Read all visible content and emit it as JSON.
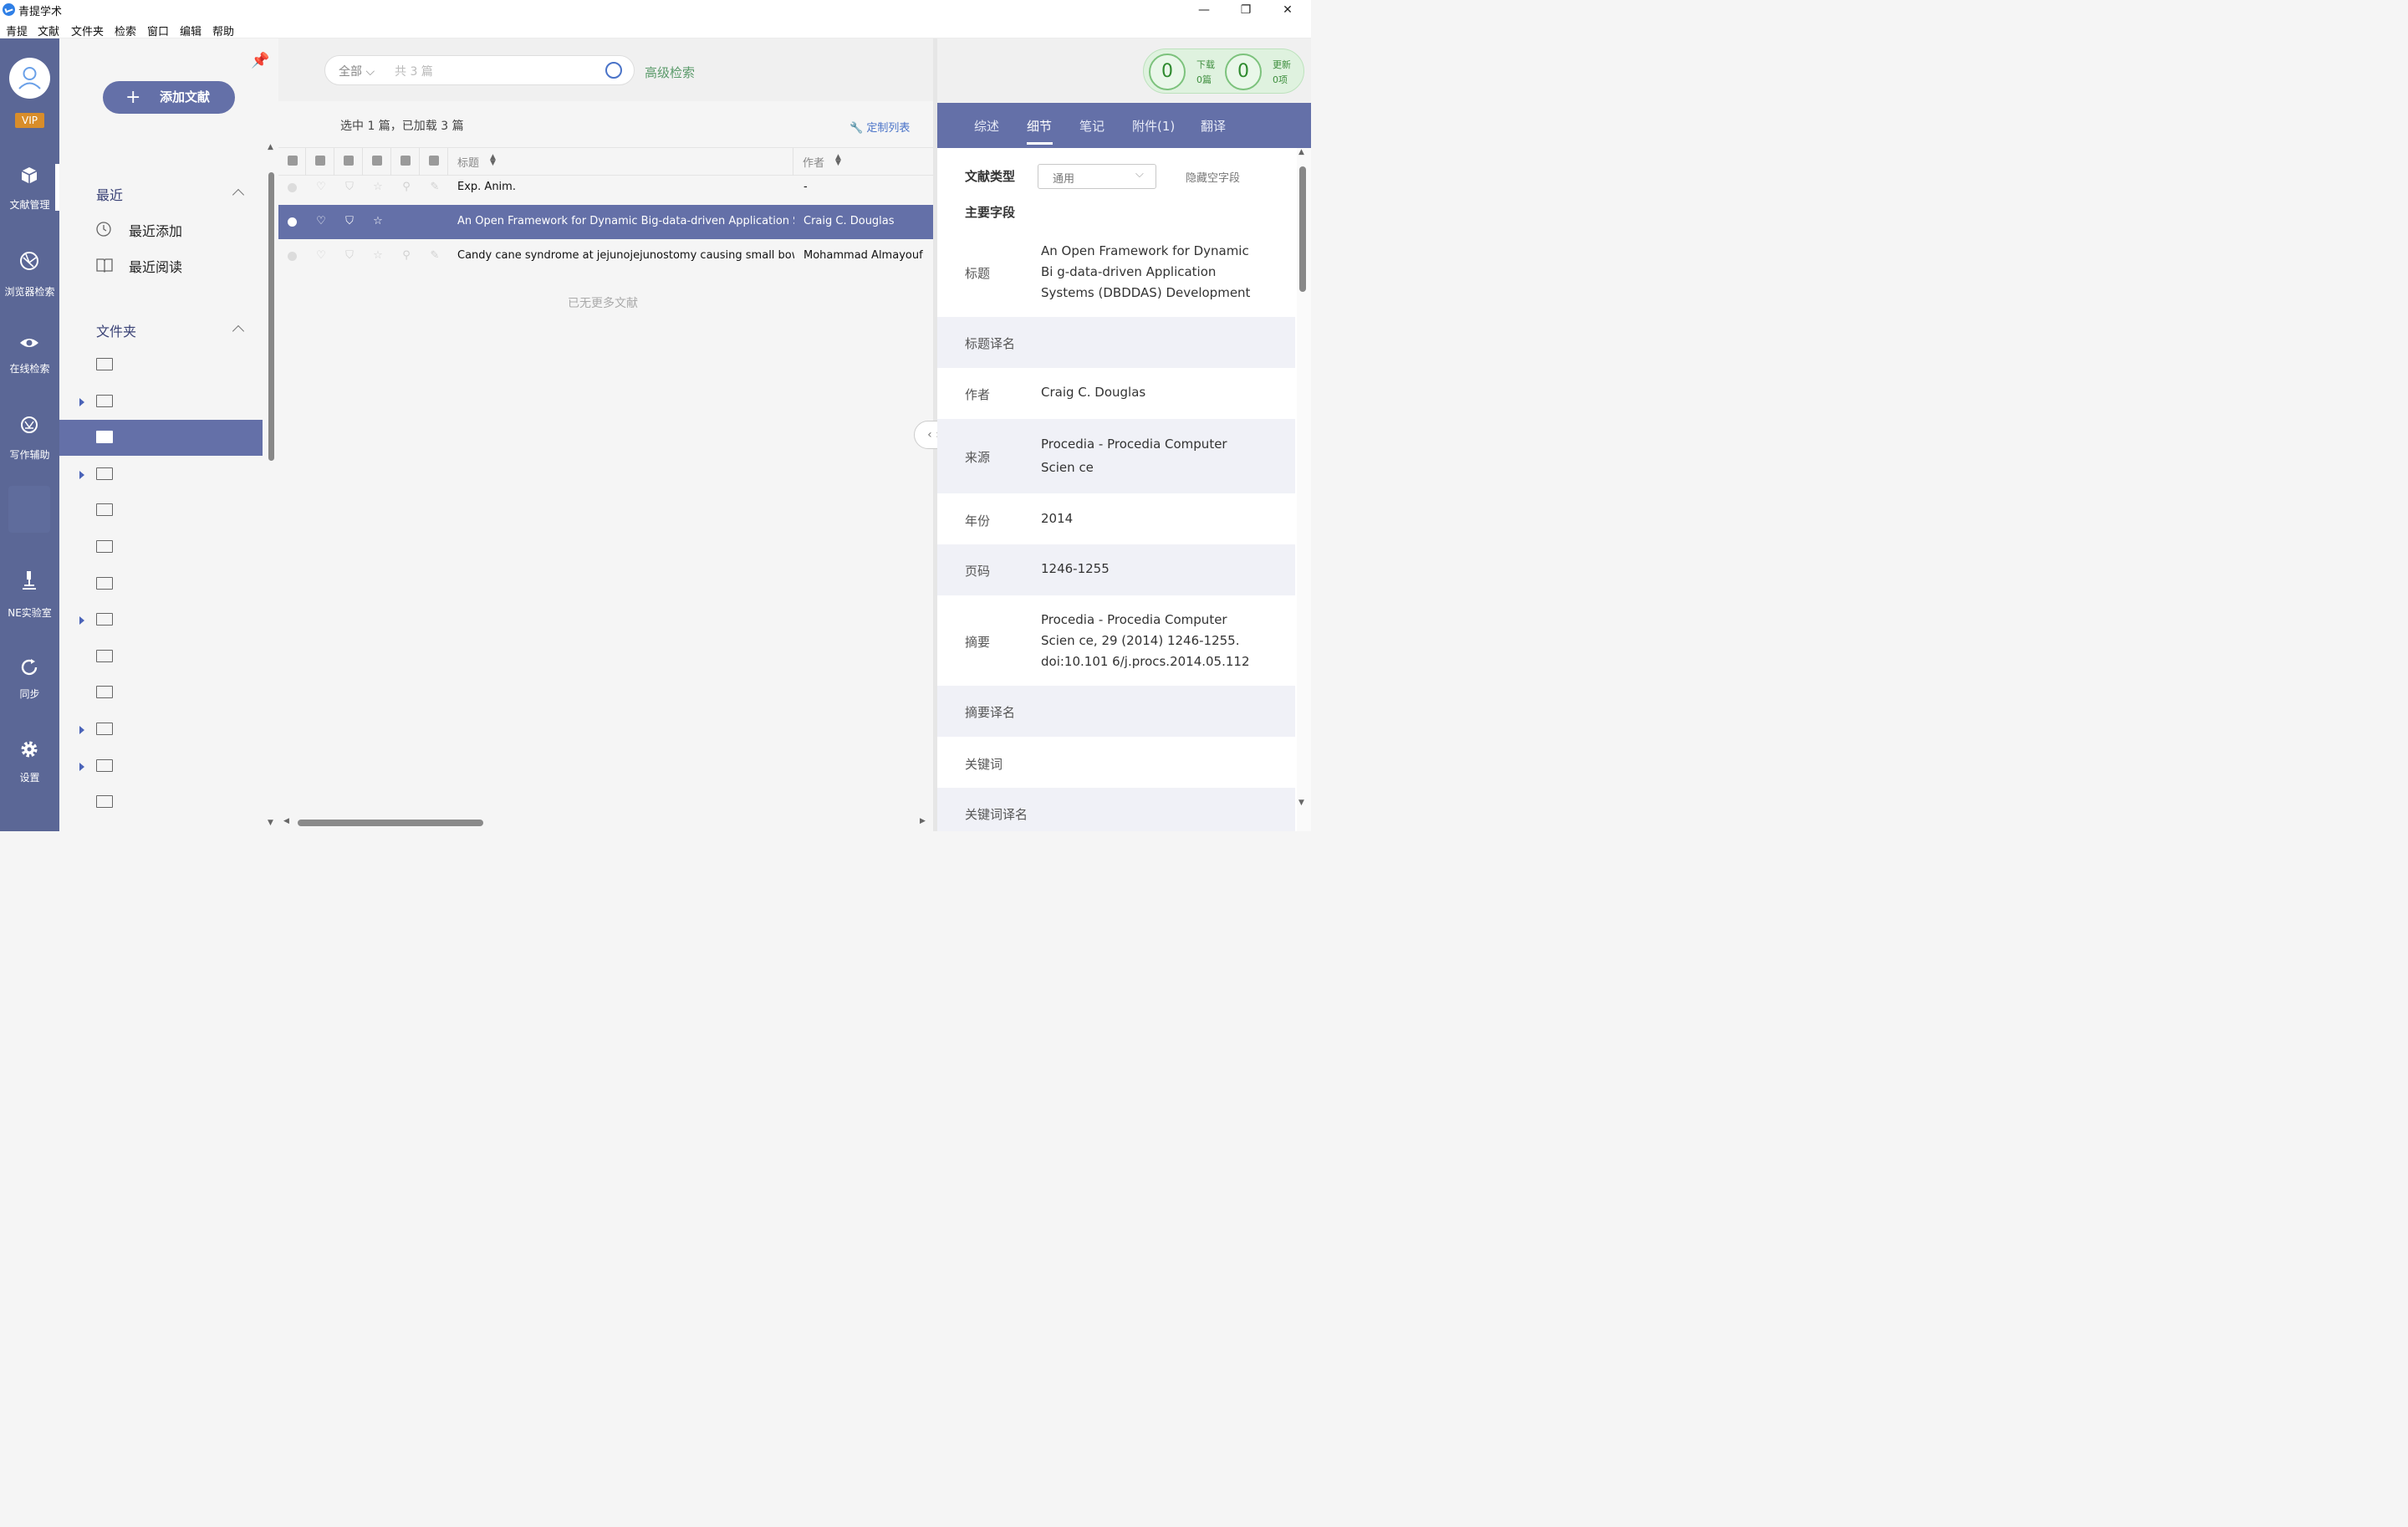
{
  "app": {
    "title": "青提学术"
  },
  "window_controls": {
    "minimize": "—",
    "maximize": "❐",
    "close": "✕"
  },
  "menu": [
    "青提",
    "文献",
    "文件夹",
    "检索",
    "窗口",
    "编辑",
    "帮助"
  ],
  "nav": {
    "vip": "VIP",
    "items": [
      {
        "label": "文献管理",
        "icon": "box-icon",
        "active": true
      },
      {
        "label": "浏览器检索",
        "icon": "globe-icon"
      },
      {
        "label": "在线检索",
        "icon": "eye-icon"
      },
      {
        "label": "写作辅助",
        "icon": "ai-knot-icon"
      },
      {
        "label": "NE实验室",
        "icon": "microscope-icon"
      },
      {
        "label": "同步",
        "icon": "sync-icon"
      },
      {
        "label": "设置",
        "icon": "gear-icon"
      }
    ]
  },
  "sidebar": {
    "add_button": "添加文献",
    "recent_title": "最近",
    "recent_items": [
      {
        "label": "最近添加",
        "icon": "clock-icon"
      },
      {
        "label": "最近阅读",
        "icon": "book-icon"
      }
    ],
    "folders_title": "文件夹",
    "folders": [
      {
        "expandable": false,
        "selected": false
      },
      {
        "expandable": true,
        "selected": false
      },
      {
        "expandable": false,
        "selected": true
      },
      {
        "expandable": true,
        "selected": false
      },
      {
        "expandable": false,
        "selected": false
      },
      {
        "expandable": false,
        "selected": false
      },
      {
        "expandable": false,
        "selected": false
      },
      {
        "expandable": true,
        "selected": false
      },
      {
        "expandable": false,
        "selected": false
      },
      {
        "expandable": false,
        "selected": false
      },
      {
        "expandable": true,
        "selected": false
      },
      {
        "expandable": true,
        "selected": false
      },
      {
        "expandable": false,
        "selected": false
      }
    ]
  },
  "search": {
    "scope": "全部",
    "count_placeholder": "共 3 篇",
    "advanced": "高级检索"
  },
  "list": {
    "status": "选中 1 篇，已加载 3 篇",
    "customize": "定制列表",
    "col_title": "标题",
    "col_author": "作者",
    "rows": [
      {
        "title": "Exp. Anim.",
        "author": "-",
        "selected": false
      },
      {
        "title": "An Open Framework for Dynamic Big-data-driven Application Systems (DBDDAS) Development",
        "author": "Craig C. Douglas",
        "selected": true
      },
      {
        "title": "Candy cane syndrome at jejunojejunostomy causing small bowel obstruction",
        "author": "Mohammad Almayouf",
        "selected": false
      }
    ],
    "no_more": "已无更多文献"
  },
  "counters": {
    "download": {
      "value": "0",
      "label": "下载",
      "sub": "0篇"
    },
    "update": {
      "value": "0",
      "label": "更新",
      "sub": "0项"
    }
  },
  "detail": {
    "tabs": [
      "综述",
      "细节",
      "笔记",
      "附件(1)",
      "翻译"
    ],
    "active_tab": 1,
    "type_label": "文献类型",
    "type_value": "通用",
    "hide_empty": "隐藏空字段",
    "main_fields": "主要字段",
    "fields": {
      "title_label": "标题",
      "title_value": "An Open Framework for Dynamic Bi g-data-driven Application Systems (DBDDAS) Development",
      "title_trans_label": "标题译名",
      "author_label": "作者",
      "author_value": "Craig C. Douglas",
      "source_label": "来源",
      "source_value": "Procedia - Procedia Computer Scien ce",
      "year_label": "年份",
      "year_value": "2014",
      "pages_label": "页码",
      "pages_value": "1246-1255",
      "abstract_label": "摘要",
      "abstract_value": "Procedia - Procedia Computer Scien ce, 29 (2014) 1246-1255. doi:10.101 6/j.procs.2014.05.112",
      "abstract_trans_label": "摘要译名",
      "keywords_label": "关键词",
      "keywords_trans_label": "关键词译名"
    }
  }
}
